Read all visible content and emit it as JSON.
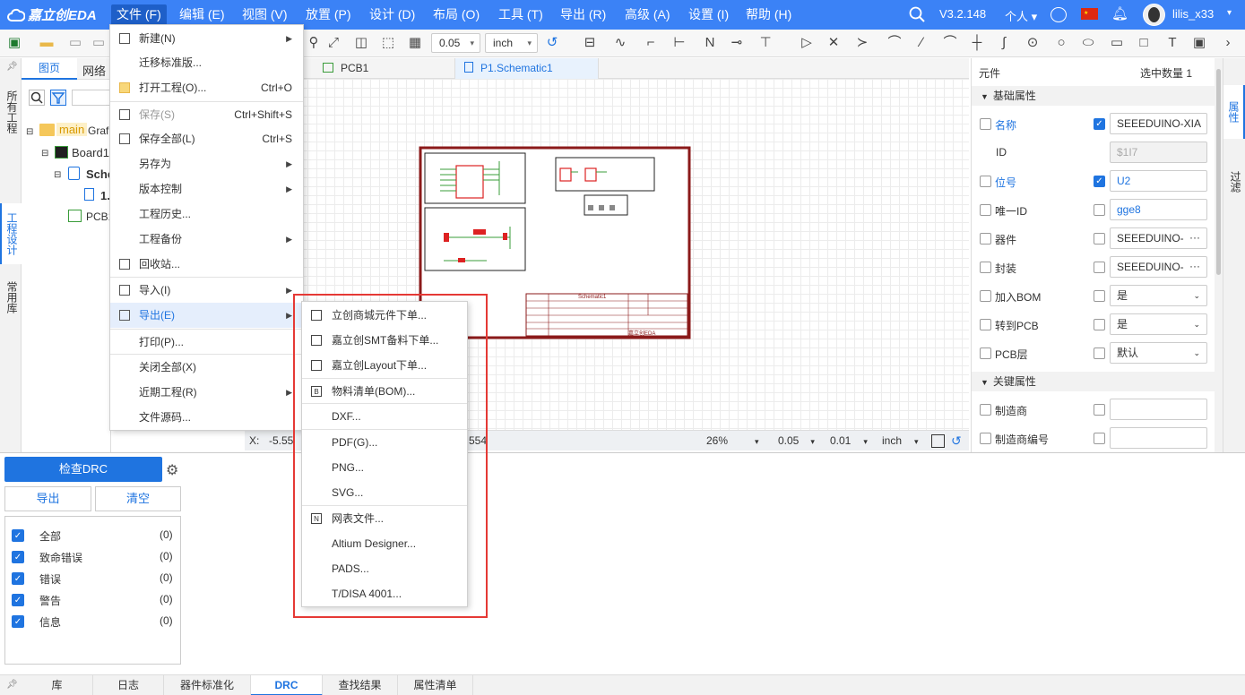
{
  "app": {
    "logo_text": "嘉立创EDA",
    "version": "V3.2.148",
    "mode": "个人",
    "user": "lilis_x33"
  },
  "menubar": [
    {
      "label": "文件 (F)",
      "active": true
    },
    {
      "label": "编辑 (E)"
    },
    {
      "label": "视图 (V)"
    },
    {
      "label": "放置 (P)"
    },
    {
      "label": "设计 (D)"
    },
    {
      "label": "布局 (O)"
    },
    {
      "label": "工具 (T)"
    },
    {
      "label": "导出 (R)"
    },
    {
      "label": "高级 (A)"
    },
    {
      "label": "设置 (I)"
    },
    {
      "label": "帮助 (H)"
    }
  ],
  "toolbar": {
    "grid_value": "0.05",
    "unit": "inch"
  },
  "left_tabs": [
    "所有工程",
    "工程设计",
    "常用库"
  ],
  "left_panel": {
    "tabs": [
      "图页",
      "网络"
    ],
    "tree": [
      {
        "label": "main",
        "sub": "Graf"
      },
      {
        "label": "Board1"
      },
      {
        "label": "Sche"
      },
      {
        "label": "1."
      },
      {
        "label": "PCB1"
      }
    ]
  },
  "doc_tabs": [
    "PCB1",
    "P1.Schematic1"
  ],
  "status": {
    "x_label": "X:",
    "x_value": "-5.55",
    "y_tail": "554",
    "zoom": "26%",
    "grid1": "0.05",
    "grid2": "0.01",
    "unit": "inch"
  },
  "file_menu": [
    {
      "label": "新建(N)",
      "icon": "new-file-icon",
      "arrow": true
    },
    {
      "label": "迁移标准版..."
    },
    {
      "label": "打开工程(O)...",
      "icon": "folder-icon",
      "shortcut": "Ctrl+O"
    },
    {
      "label": "保存(S)",
      "icon": "save-icon",
      "shortcut": "Ctrl+Shift+S",
      "disabled": true
    },
    {
      "label": "保存全部(L)",
      "icon": "save-all-icon",
      "shortcut": "Ctrl+S"
    },
    {
      "label": "另存为",
      "arrow": true
    },
    {
      "label": "版本控制",
      "arrow": true
    },
    {
      "label": "工程历史..."
    },
    {
      "label": "工程备份",
      "arrow": true
    },
    {
      "label": "回收站...",
      "icon": "trash-icon"
    },
    {
      "label": "导入(I)",
      "icon": "import-icon",
      "arrow": true
    },
    {
      "label": "导出(E)",
      "icon": "export-icon",
      "arrow": true,
      "highlight": true
    },
    {
      "label": "打印(P)..."
    },
    {
      "label": "关闭全部(X)"
    },
    {
      "label": "近期工程(R)",
      "arrow": true
    },
    {
      "label": "文件源码..."
    }
  ],
  "export_menu": [
    {
      "label": "立创商城元件下单...",
      "icon": "cart-icon"
    },
    {
      "label": "嘉立创SMT备料下单...",
      "icon": "cart-icon"
    },
    {
      "label": "嘉立创Layout下单...",
      "icon": "cart-icon"
    },
    {
      "label": "物料清单(BOM)...",
      "icon": "bom-icon"
    },
    {
      "label": "DXF..."
    },
    {
      "label": "PDF(G)..."
    },
    {
      "label": "PNG..."
    },
    {
      "label": "SVG..."
    },
    {
      "label": "网表文件...",
      "icon": "netlist-icon"
    },
    {
      "label": "Altium Designer..."
    },
    {
      "label": "PADS..."
    },
    {
      "label": "T/DISA 4001..."
    }
  ],
  "right_panel": {
    "header_left": "元件",
    "header_right": "选中数量  1",
    "section_basic": "基础属性",
    "section_key": "关键属性",
    "rows": [
      {
        "label": "名称",
        "blue": true,
        "checked": true,
        "value": "SEEEDUINO-XIA"
      },
      {
        "label": "ID",
        "value": "$1I7",
        "readonly": true
      },
      {
        "label": "位号",
        "blue": true,
        "checked": true,
        "value": "U2",
        "blue_value": true
      },
      {
        "label": "唯一ID",
        "value": "gge8",
        "blue_value": true
      },
      {
        "label": "器件",
        "value": "SEEEDUINO-",
        "more": true
      },
      {
        "label": "封装",
        "value": "SEEEDUINO-",
        "more": true
      },
      {
        "label": "加入BOM",
        "value": "是",
        "dropdown": true
      },
      {
        "label": "转到PCB",
        "value": "是",
        "dropdown": true
      },
      {
        "label": "PCB层",
        "value": "默认",
        "dropdown": true
      }
    ],
    "key_rows": [
      {
        "label": "制造商",
        "value": ""
      },
      {
        "label": "制造商编号",
        "value": ""
      }
    ]
  },
  "right_tabs": [
    "属性",
    "过滤"
  ],
  "drc": {
    "check_label": "检查DRC",
    "export_label": "导出",
    "clear_label": "清空",
    "items": [
      {
        "label": "全部",
        "count": "(0)"
      },
      {
        "label": "致命错误",
        "count": "(0)"
      },
      {
        "label": "错误",
        "count": "(0)"
      },
      {
        "label": "警告",
        "count": "(0)"
      },
      {
        "label": "信息",
        "count": "(0)"
      }
    ]
  },
  "bottom_tabs": [
    "库",
    "日志",
    "器件标准化",
    "DRC",
    "查找结果",
    "属性清单"
  ],
  "schematic": {
    "title_text": "Schematic1",
    "brand": "嘉立创EDA"
  },
  "colors": {
    "brand": "#3b82f6",
    "highlight_box": "#e53935",
    "accent": "#1f74e0"
  }
}
